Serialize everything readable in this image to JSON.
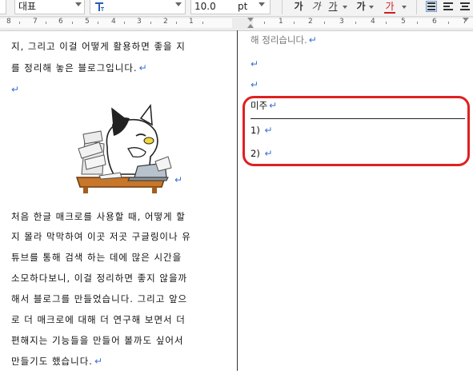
{
  "toolbar": {
    "style_name": "대표",
    "font_icon": "font-type-icon",
    "font_size": "10.0",
    "font_unit": "pt",
    "char_buttons": [
      "가",
      "가",
      "가",
      "가",
      "가"
    ],
    "text_color": "#d01e1e",
    "align_icons": [
      "align-justify-icon",
      "align-left-icon",
      "align-center-icon"
    ]
  },
  "ruler": {
    "left_numbers": [
      "8",
      "7",
      "6",
      "5",
      "4",
      "3",
      "2",
      "1"
    ],
    "right_numbers": [
      "1",
      "2",
      "3",
      "4",
      "5",
      "6",
      "7"
    ]
  },
  "left_column": {
    "lines": [
      "지, 그리고 이걸 어떻게 활용하면 좋을 지",
      "를 정리해 놓은 블로그입니다.",
      "",
      "처음 한글 매크로를 사용할 때, 어떻게 할",
      "지 몰라 막막하여 이곳 저곳 구글링이나 유",
      "튜브를 통해 검색 하는 데에 많은 시간을",
      "소모하다보니, 이걸 정리하면 좋지 않을까",
      "해서 블로그를 만들었습니다. 그리고 앞으",
      "로 더 매크로에 대해 더 연구해 보면서 더",
      "편해지는 기능들을 만들어 볼까도 싶어서",
      "만들기도 했습니다."
    ],
    "image": "cat-at-laptop-illustration"
  },
  "right_column": {
    "top_text": "해 정리습니다.",
    "footnote_title": "미주",
    "items": [
      "1)",
      "2)"
    ]
  },
  "colors": {
    "highlight": "#e02020",
    "para_mark": "#3b6fd3"
  }
}
